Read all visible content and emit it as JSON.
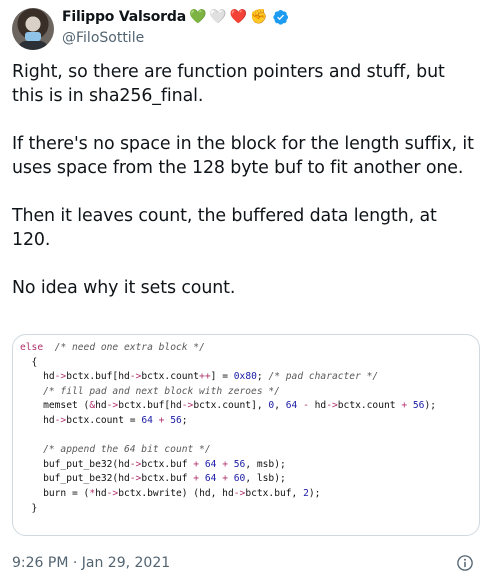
{
  "author": {
    "display_name": "Filippo Valsorda",
    "handle": "@FiloSottile",
    "emojis": [
      "💚",
      "🤍",
      "❤️",
      "✊"
    ]
  },
  "tweet": {
    "paragraphs": [
      "Right, so there are function pointers and stuff, but this is in sha256_final.",
      "If there's no space in the block for the length suffix, it uses space from the 128 byte buf to fit another one.",
      "Then it leaves count, the buffered data length, at 120.",
      "No idea why it sets count."
    ]
  },
  "code_image": {
    "lines": [
      "else  /* need one extra block */",
      "  {",
      "    hd->bctx.buf[hd->bctx.count++] = 0x80; /* pad character */",
      "    /* fill pad and next block with zeroes */",
      "    memset (&hd->bctx.buf[hd->bctx.count], 0, 64 - hd->bctx.count + 56);",
      "    hd->bctx.count = 64 + 56;",
      "",
      "    /* append the 64 bit count */",
      "    buf_put_be32(hd->bctx.buf + 64 + 56, msb);",
      "    buf_put_be32(hd->bctx.buf + 64 + 60, lsb);",
      "    burn = (*hd->bctx.bwrite) (hd, hd->bctx.buf, 2);",
      "  }"
    ]
  },
  "meta": {
    "timestamp": "9:26 PM · Jan 29, 2021"
  },
  "colors": {
    "text": "#0f1419",
    "secondary": "#536471",
    "verified": "#1d9bf0",
    "border": "#cfd9de"
  }
}
